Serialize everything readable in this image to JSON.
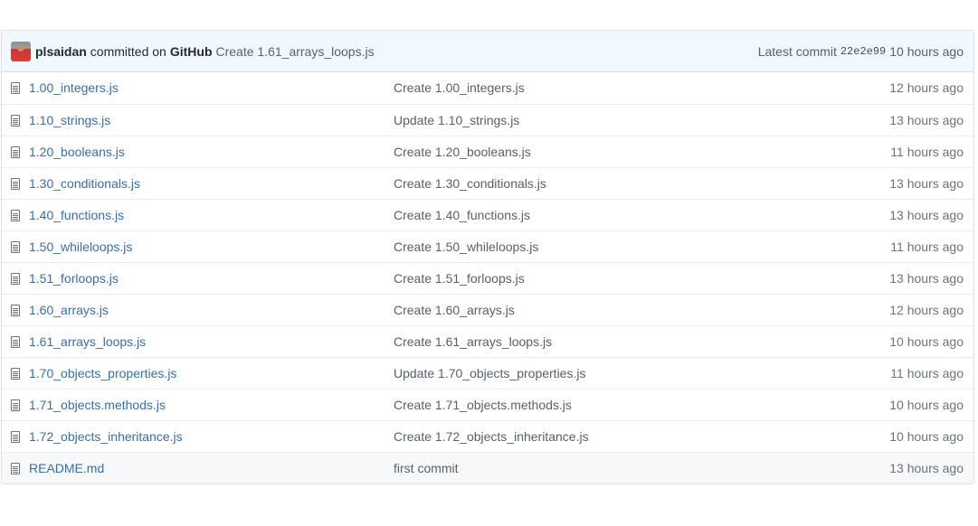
{
  "commit": {
    "author": "plsaidan",
    "committed_text": "committed on",
    "committer": "GitHub",
    "message": "Create 1.61_arrays_loops.js",
    "latest_label": "Latest commit",
    "sha": "22e2e99",
    "age": "10 hours ago"
  },
  "files": [
    {
      "name": "1.00_integers.js",
      "message": "Create 1.00_integers.js",
      "age": "12 hours ago"
    },
    {
      "name": "1.10_strings.js",
      "message": "Update 1.10_strings.js",
      "age": "13 hours ago"
    },
    {
      "name": "1.20_booleans.js",
      "message": "Create 1.20_booleans.js",
      "age": "11 hours ago"
    },
    {
      "name": "1.30_conditionals.js",
      "message": "Create 1.30_conditionals.js",
      "age": "13 hours ago"
    },
    {
      "name": "1.40_functions.js",
      "message": "Create 1.40_functions.js",
      "age": "13 hours ago"
    },
    {
      "name": "1.50_whileloops.js",
      "message": "Create 1.50_whileloops.js",
      "age": "11 hours ago"
    },
    {
      "name": "1.51_forloops.js",
      "message": "Create 1.51_forloops.js",
      "age": "13 hours ago"
    },
    {
      "name": "1.60_arrays.js",
      "message": "Create 1.60_arrays.js",
      "age": "12 hours ago"
    },
    {
      "name": "1.61_arrays_loops.js",
      "message": "Create 1.61_arrays_loops.js",
      "age": "10 hours ago"
    },
    {
      "name": "1.70_objects_properties.js",
      "message": "Update 1.70_objects_properties.js",
      "age": "11 hours ago"
    },
    {
      "name": "1.71_objects.methods.js",
      "message": "Create 1.71_objects.methods.js",
      "age": "10 hours ago"
    },
    {
      "name": "1.72_objects_inheritance.js",
      "message": "Create 1.72_objects_inheritance.js",
      "age": "10 hours ago"
    },
    {
      "name": "README.md",
      "message": "first commit",
      "age": "13 hours ago"
    }
  ],
  "icons": {
    "file": "file-icon",
    "avatar": "avatar"
  },
  "colors": {
    "link": "#3a6ea5",
    "commit_bg": "#f1f8ff",
    "muted": "#586069"
  }
}
